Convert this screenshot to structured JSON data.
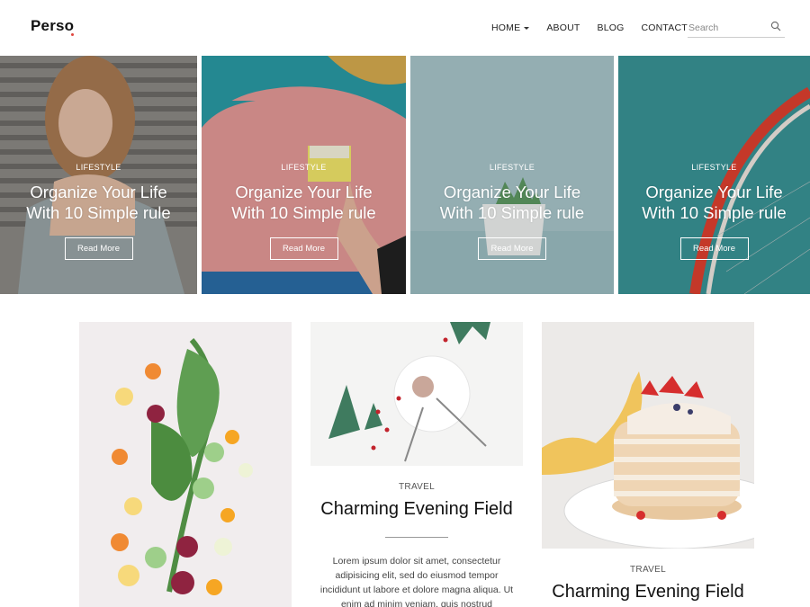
{
  "site": {
    "logo": "Perso",
    "brand_accent": "#e0473f"
  },
  "nav": {
    "items": [
      {
        "label": "HOME",
        "has_dropdown": true
      },
      {
        "label": "ABOUT"
      },
      {
        "label": "BLOG"
      },
      {
        "label": "CONTACT"
      }
    ],
    "search_placeholder": "Search",
    "search_icon": "search-icon"
  },
  "hero": [
    {
      "category": "LIFESTYLE",
      "title_line1": "Organize Your Life",
      "title_line2": "With 10 Simple rule",
      "button": "Read More"
    },
    {
      "category": "LIFESTYLE",
      "title_line1": "Organize Your Life",
      "title_line2": "With 10 Simple rule",
      "button": "Read More"
    },
    {
      "category": "LIFESTYLE",
      "title_line1": "Organize Your Life",
      "title_line2": "With 10 Simple rule",
      "button": "Read More"
    },
    {
      "category": "LIFESTYLE",
      "title_line1": "Organize Your Life",
      "title_line2": "With 10 Simple rule",
      "button": "Read More"
    }
  ],
  "cards": [
    {
      "image": "vegetables-photo"
    },
    {
      "image": "plate-photo",
      "category": "TRAVEL",
      "title": "Charming Evening Field",
      "excerpt": "Lorem ipsum dolor sit amet, consectetur adipisicing elit, sed do eiusmod tempor incididunt ut labore et dolore magna aliqua. Ut enim ad minim veniam, quis nostrud exercitation ullamco"
    },
    {
      "image": "pancakes-photo",
      "category": "TRAVEL",
      "title": "Charming Evening Field"
    }
  ]
}
